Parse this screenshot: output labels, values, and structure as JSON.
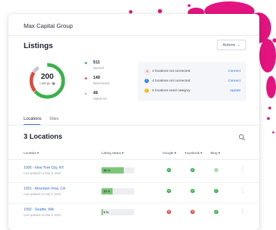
{
  "org": {
    "name": "Max Capital Group"
  },
  "listings": {
    "title": "Listings",
    "actions_label": "Actions",
    "total": "200",
    "total_label": "Listings",
    "stats": [
      {
        "value": "511",
        "label": "Synced",
        "color": "#3cb04a"
      },
      {
        "value": "140",
        "label": "Need action",
        "color": "#e2493d"
      },
      {
        "value": "49",
        "label": "Opted out",
        "color": "#c3c7cf"
      }
    ],
    "donut_fractions": {
      "synced": 0.73,
      "need_action": 0.2,
      "opted_out": 0.07
    }
  },
  "connections": [
    {
      "icon": "google-icon",
      "text": "4 locations not connected",
      "action": "Connect",
      "color": "#ea4335"
    },
    {
      "icon": "facebook-icon",
      "text": "4 locations not connected",
      "action": "Connect",
      "color": "#1877f2"
    },
    {
      "icon": "warning-icon",
      "text": "5 locations need category",
      "action": "Update",
      "color": "#f5b400"
    }
  ],
  "tabs": [
    {
      "label": "Locations",
      "active": true
    },
    {
      "label": "Sites",
      "active": false
    }
  ],
  "locations": {
    "count_title": "3 Locations",
    "columns": [
      "Location",
      "Listing status",
      "Google",
      "Facebook",
      "Bing"
    ],
    "rows": [
      {
        "name": "1000 - New York City, NY",
        "updated": "Last updated on Mar 5, 2023",
        "status_pct": "96 %",
        "status_fraction": 0.68,
        "google": "ok",
        "facebook": "ok",
        "bing": "pending"
      },
      {
        "name": "1001 - Mountain View, CA",
        "updated": "Last updated on Mar 5, 2023",
        "status_pct": "33 %",
        "status_fraction": 0.34,
        "google": "ok",
        "facebook": "ok",
        "bing": "ok"
      },
      {
        "name": "1002 - Seattle, WA",
        "updated": "Last updated on Mar 5, 2023",
        "status_pct": "5 %",
        "status_fraction": 0.05,
        "google": "error",
        "facebook": "error",
        "bing": "ok"
      }
    ]
  },
  "colors": {
    "accent": "#2f6fd6",
    "ok": "#3cb04a",
    "error": "#e2493d",
    "pending": "#a9dca6",
    "splash": "#e3137f"
  }
}
